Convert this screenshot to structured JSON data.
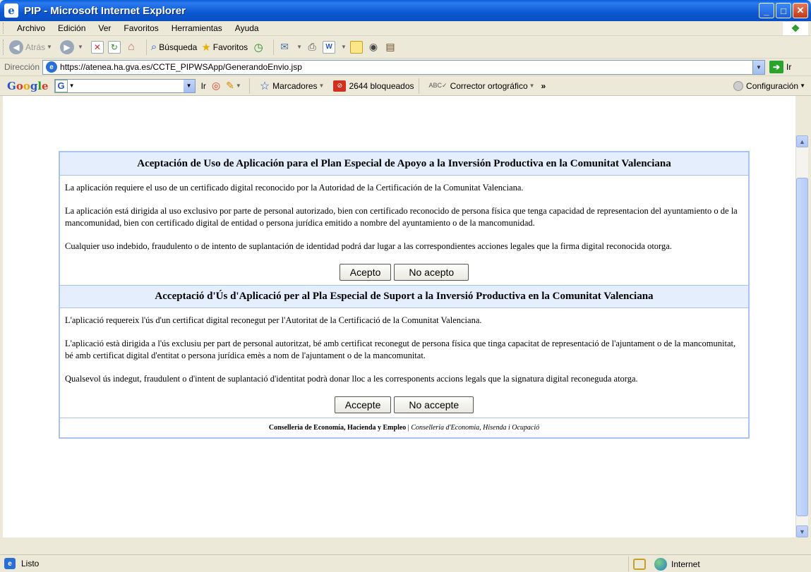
{
  "window": {
    "title": "PIP - Microsoft Internet Explorer",
    "app_icon_glyph": "e"
  },
  "menu": [
    {
      "label": "Archivo"
    },
    {
      "label": "Edición"
    },
    {
      "label": "Ver"
    },
    {
      "label": "Favoritos"
    },
    {
      "label": "Herramientas"
    },
    {
      "label": "Ayuda"
    }
  ],
  "toolbar": {
    "back_label": "Atrás",
    "search_label": "Búsqueda",
    "favorites_label": "Favoritos"
  },
  "address": {
    "label": "Dirección",
    "url": "https://atenea.ha.gva.es/CCTE_PIPWSApp/GenerandoEnvio.jsp",
    "go_label": "Ir"
  },
  "google": {
    "go_label": "Ir",
    "bookmarks_label": "Marcadores",
    "blocked_label": "2644 bloqueados",
    "spell_label": "Corrector ortográfico",
    "config_label": "Configuración"
  },
  "spanish": {
    "title": "Aceptación de Uso de Aplicación para el Plan Especial de Apoyo a la Inversión Productiva en la Comunitat Valenciana",
    "p1": "La aplicación requiere el uso de un certificado digital reconocido por la Autoridad de la Certificación de la Comunitat Valenciana.",
    "p2": "La aplicación está dirigida al uso exclusivo por parte de personal autorizado, bien con certificado reconocido de persona física que tenga capacidad de representacion del ayuntamiento o de la mancomunidad, bien con certificado digital de entidad o persona jurídica emitido a nombre del ayuntamiento o de la mancomunidad.",
    "p3": "Cualquier uso indebido, fraudulento o de intento de suplantación de identidad podrá dar lugar a las correspondientes acciones legales que la firma digital reconocida otorga.",
    "accept": "Acepto",
    "reject": "No acepto"
  },
  "valencian": {
    "title": "Acceptació d'Ús d'Aplicació per al Pla Especial de Suport a la Inversió Productiva en la Comunitat Valenciana",
    "p1": "L'aplicació requereix l'ús d'un certificat digital reconegut per l'Autoritat de la Certificació de la Comunitat Valenciana.",
    "p2": "L'aplicació està dirigida a l'ús exclusiu per part de personal autoritzat, bé amb certificat reconegut de persona física que tinga capacitat de representació de l'ajuntament o de la mancomunitat, bé amb certificat digital d'entitat o persona jurídica emès a nom de l'ajuntament o de la mancomunitat.",
    "p3": "Qualsevol ús indegut, fraudulent o d'intent de suplantació d'identitat podrà donar lloc a les corresponents accions legals que la signatura digital reconeguda atorga.",
    "accept": "Accepte",
    "reject": "No accepte"
  },
  "footer": {
    "spanish": "Conselleria de Economía, Hacienda y Empleo",
    "separator": " | ",
    "valencian": "Conselleria d'Economia, Hisenda i Ocupació"
  },
  "status": {
    "text": "Listo",
    "zone": "Internet"
  },
  "colors": {
    "header_bg": "#e4eefd",
    "panel_border": "#a8c4ec",
    "titlebar": "#0b58d1"
  }
}
